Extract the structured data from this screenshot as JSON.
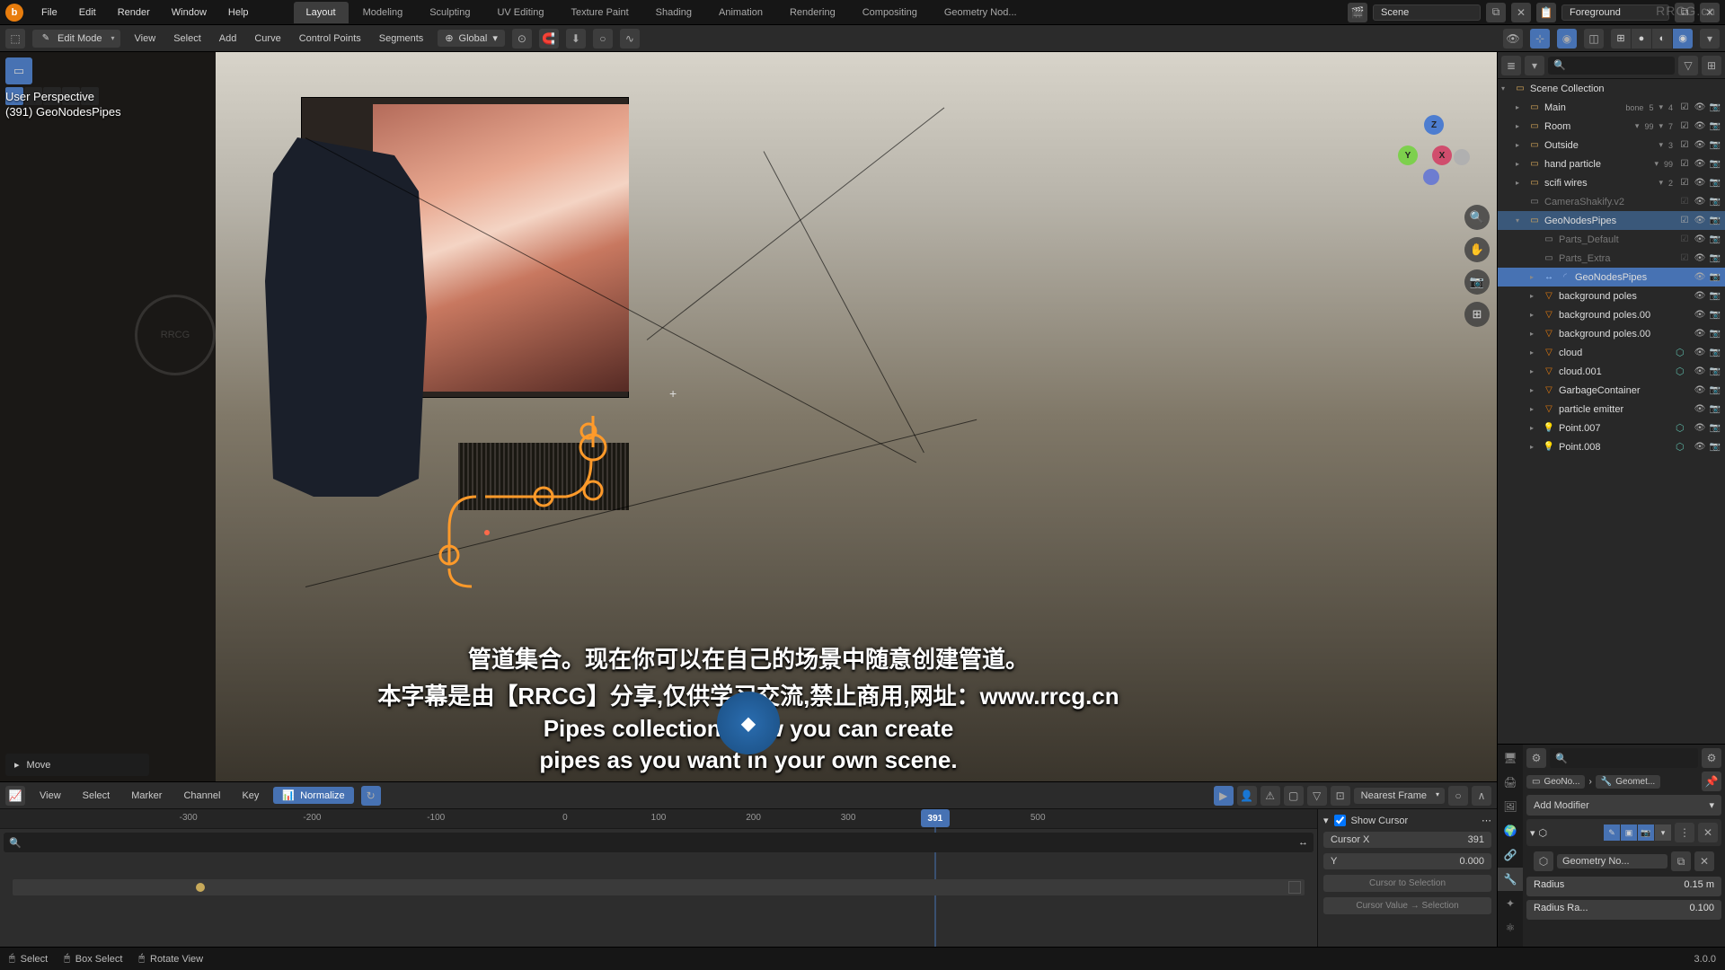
{
  "topbar": {
    "menus": [
      "File",
      "Edit",
      "Render",
      "Window",
      "Help"
    ],
    "workspaces": [
      "Layout",
      "Modeling",
      "Sculpting",
      "UV Editing",
      "Texture Paint",
      "Shading",
      "Animation",
      "Rendering",
      "Compositing",
      "Geometry Nod..."
    ],
    "active_workspace": "Layout",
    "scene_label": "Scene",
    "view_layer_label": "Foreground"
  },
  "viewport_toolbar": {
    "mode": "Edit Mode",
    "menus": [
      "View",
      "Select",
      "Add",
      "Curve",
      "Control Points",
      "Segments"
    ],
    "orientation": "Global"
  },
  "viewport": {
    "header_line1": "User Perspective",
    "header_line2": "(391) GeoNodesPipes",
    "move_op": "Move",
    "edit_point": "+",
    "gizmo": {
      "z": "Z",
      "y": "Y",
      "x": "X"
    }
  },
  "outliner": {
    "scene_collection": "Scene Collection",
    "rows": [
      {
        "name": "Main",
        "indent": 1,
        "icon": "coll",
        "grey": false,
        "arrow": true,
        "suffixes": [
          "bone",
          "5",
          "▾",
          "4"
        ],
        "toggles": [
          "cb",
          "eye",
          "cam"
        ]
      },
      {
        "name": "Room",
        "indent": 1,
        "icon": "coll",
        "grey": false,
        "arrow": true,
        "suffixes": [
          "▾",
          "99",
          "▾",
          "7"
        ],
        "toggles": [
          "cb",
          "eye",
          "cam"
        ]
      },
      {
        "name": "Outside",
        "indent": 1,
        "icon": "coll",
        "grey": false,
        "arrow": true,
        "suffixes": [
          "▾",
          "3"
        ],
        "toggles": [
          "cb",
          "eye",
          "cam"
        ]
      },
      {
        "name": "hand particle",
        "indent": 1,
        "icon": "coll",
        "grey": false,
        "arrow": true,
        "suffixes": [
          "▾",
          "99"
        ],
        "toggles": [
          "cb",
          "eye",
          "cam"
        ]
      },
      {
        "name": "scifi wires",
        "indent": 1,
        "icon": "coll",
        "grey": false,
        "arrow": true,
        "suffixes": [
          "▾",
          "2"
        ],
        "toggles": [
          "cb",
          "eye",
          "cam"
        ]
      },
      {
        "name": "CameraShakify.v2",
        "indent": 1,
        "icon": "coll-grey",
        "grey": true,
        "arrow": false,
        "toggles": [
          "cb-off",
          "eye",
          "cam"
        ]
      },
      {
        "name": "GeoNodesPipes",
        "indent": 1,
        "icon": "coll",
        "grey": false,
        "arrow": true,
        "open": true,
        "selected": true,
        "toggles": [
          "cb",
          "eye",
          "cam"
        ]
      },
      {
        "name": "Parts_Default",
        "indent": 2,
        "icon": "coll-grey",
        "grey": true,
        "arrow": false,
        "toggles": [
          "cb-off",
          "eye",
          "cam"
        ]
      },
      {
        "name": "Parts_Extra",
        "indent": 2,
        "icon": "coll-grey",
        "grey": true,
        "arrow": false,
        "toggles": [
          "cb-off",
          "eye",
          "cam"
        ]
      },
      {
        "name": "GeoNodesPipes",
        "indent": 2,
        "icon": "obj-edit",
        "grey": false,
        "arrow": true,
        "active": true,
        "preicon": "edit",
        "toggles": [
          "eye",
          "cam"
        ]
      },
      {
        "name": "background poles",
        "indent": 2,
        "icon": "obj-mesh",
        "grey": false,
        "arrow": true,
        "toggles": [
          "eye",
          "cam"
        ]
      },
      {
        "name": "background poles.00",
        "indent": 2,
        "icon": "obj-mesh",
        "grey": false,
        "arrow": true,
        "toggles": [
          "eye",
          "cam"
        ]
      },
      {
        "name": "background poles.00",
        "indent": 2,
        "icon": "obj-mesh",
        "grey": false,
        "arrow": true,
        "toggles": [
          "eye",
          "cam"
        ]
      },
      {
        "name": "cloud",
        "indent": 2,
        "icon": "obj-mesh",
        "grey": false,
        "arrow": true,
        "suffix_icon": "mod",
        "toggles": [
          "eye",
          "cam"
        ]
      },
      {
        "name": "cloud.001",
        "indent": 2,
        "icon": "obj-mesh",
        "grey": false,
        "arrow": true,
        "suffix_icon": "mod",
        "toggles": [
          "eye",
          "cam"
        ]
      },
      {
        "name": "GarbageContainer",
        "indent": 2,
        "icon": "obj-mesh",
        "grey": false,
        "arrow": true,
        "toggles": [
          "eye",
          "cam"
        ]
      },
      {
        "name": "particle emitter",
        "indent": 2,
        "icon": "obj-mesh",
        "grey": false,
        "arrow": true,
        "toggles": [
          "eye",
          "cam"
        ]
      },
      {
        "name": "Point.007",
        "indent": 2,
        "icon": "obj-light",
        "grey": false,
        "arrow": true,
        "suffix_icon": "mod",
        "toggles": [
          "eye",
          "cam"
        ]
      },
      {
        "name": "Point.008",
        "indent": 2,
        "icon": "obj-light",
        "grey": false,
        "arrow": true,
        "suffix_icon": "mod",
        "toggles": [
          "eye",
          "cam"
        ]
      }
    ]
  },
  "graph": {
    "menus": [
      "View",
      "Select",
      "Marker",
      "Channel",
      "Key"
    ],
    "normalize": "Normalize",
    "nearest_frame": "Nearest Frame",
    "playhead": "391",
    "ticks": [
      {
        "label": "-300",
        "pct": 14.3
      },
      {
        "label": "-200",
        "pct": 23.7
      },
      {
        "label": "-100",
        "pct": 33.1
      },
      {
        "label": "0",
        "pct": 42.9
      },
      {
        "label": "100",
        "pct": 50.0
      },
      {
        "label": "200",
        "pct": 57.2
      },
      {
        "label": "300",
        "pct": 64.4
      },
      {
        "label": "500",
        "pct": 78.8
      }
    ],
    "playhead_pct": 71.0,
    "side": {
      "show_cursor": "Show Cursor",
      "cursor_x_label": "Cursor X",
      "cursor_x_value": "391",
      "cursor_y_label": "Y",
      "cursor_y_value": "0.000",
      "btn1": "Cursor to Selection",
      "btn2": "Cursor Value → Selection"
    }
  },
  "properties": {
    "crumb_obj": "GeoNo...",
    "crumb_mod": "Geomet...",
    "add_modifier": "Add Modifier",
    "mod_node_group": "Geometry No...",
    "radius_label": "Radius",
    "radius_value": "0.15 m",
    "radius_rand_label": "Radius Ra...",
    "radius_rand_value": "0.100"
  },
  "statusbar": {
    "select": "Select",
    "box_select": "Box Select",
    "rotate_view": "Rotate View",
    "version": "3.0.0"
  },
  "subtitles": {
    "line1": "管道集合。现在你可以在自己的场景中随意创建管道。",
    "line2": "本字幕是由【RRCG】分享,仅供学习交流,禁止商用,网址：www.rrcg.cn",
    "line3": "Pipes collection. Now you can create",
    "line4": "pipes as you want in your own scene."
  },
  "watermarks": {
    "top_right": "RRCG.cn",
    "bottom_logo": "RRCG"
  }
}
